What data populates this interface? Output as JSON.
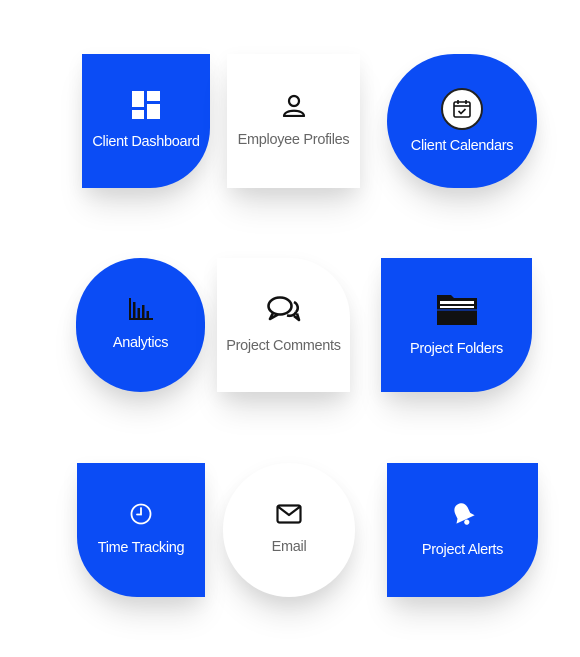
{
  "tiles": [
    {
      "label": "Client Dashboard",
      "icon": "dashboard-icon"
    },
    {
      "label": "Employee Profiles",
      "icon": "user-icon"
    },
    {
      "label": "Client Calendars",
      "icon": "calendar-check-icon"
    },
    {
      "label": "Analytics",
      "icon": "bar-chart-icon"
    },
    {
      "label": "Project Comments",
      "icon": "comments-icon"
    },
    {
      "label": "Project Folders",
      "icon": "folder-icon"
    },
    {
      "label": "Time Tracking",
      "icon": "clock-icon"
    },
    {
      "label": "Email",
      "icon": "envelope-icon"
    },
    {
      "label": "Project Alerts",
      "icon": "bell-icon"
    }
  ],
  "colors": {
    "accent": "#0b4cf5",
    "tile_white": "#ffffff",
    "text_on_accent": "#ffffff",
    "text_muted": "#666666"
  }
}
